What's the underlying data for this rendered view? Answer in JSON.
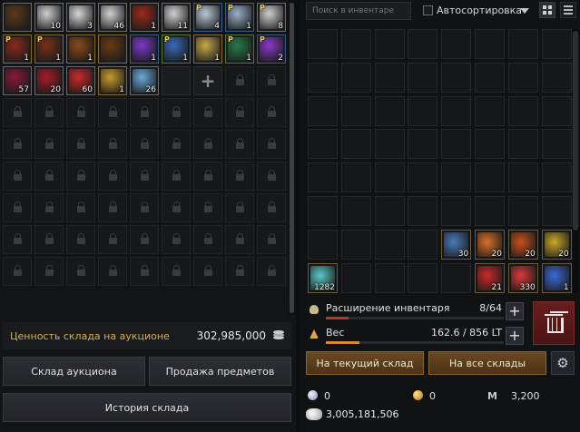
{
  "storage": {
    "slots": [
      {
        "item": "magnifier-key",
        "count": "",
        "grade": "white",
        "p": false,
        "color": "#5a3a1a"
      },
      {
        "item": "paper-map",
        "count": "10",
        "grade": "white",
        "p": false,
        "color": "#cfcfcf"
      },
      {
        "item": "paper-map",
        "count": "3",
        "grade": "white",
        "p": false,
        "color": "#d7d7d7"
      },
      {
        "item": "paper-map",
        "count": "46",
        "grade": "white",
        "p": false,
        "color": "#d2d2d2"
      },
      {
        "item": "red-pouch",
        "count": "1",
        "grade": "white",
        "p": false,
        "color": "#9a2a1a"
      },
      {
        "item": "paper-map",
        "count": "11",
        "grade": "white",
        "p": false,
        "color": "#d0d0d0"
      },
      {
        "item": "ornate-horn",
        "count": "4",
        "grade": "blue",
        "p": true,
        "color": "#b8c8d8"
      },
      {
        "item": "ornate-horn",
        "count": "1",
        "grade": "blue",
        "p": true,
        "color": "#9ab0c8"
      },
      {
        "item": "paper-map",
        "count": "8",
        "grade": "white",
        "p": true,
        "color": "#cfcfcf"
      },
      {
        "item": "treasure-chest",
        "count": "1",
        "grade": "gold",
        "p": true,
        "color": "#8a2a1a"
      },
      {
        "item": "treasure-chest",
        "count": "1",
        "grade": "gold",
        "p": true,
        "color": "#7a3018"
      },
      {
        "item": "treasure-chest",
        "count": "1",
        "grade": "gold",
        "p": false,
        "color": "#8a4a1a"
      },
      {
        "item": "treasure-chest",
        "count": "",
        "grade": "gold",
        "p": false,
        "color": "#6a3a14"
      },
      {
        "item": "purple-crystal",
        "count": "1",
        "grade": "blue",
        "p": false,
        "color": "#7a3ac8"
      },
      {
        "item": "blue-scroll",
        "count": "1",
        "grade": "green",
        "p": true,
        "color": "#3a6ab8"
      },
      {
        "item": "gold-crest",
        "count": "1",
        "grade": "gold",
        "p": false,
        "color": "#c8a84a"
      },
      {
        "item": "emerald-medal",
        "count": "1",
        "grade": "green",
        "p": true,
        "color": "#2a7a4a"
      },
      {
        "item": "purple-chest",
        "count": "2",
        "grade": "blue",
        "p": true,
        "color": "#8a3ac8"
      },
      {
        "item": "crimson-claw",
        "count": "57",
        "grade": "white",
        "p": false,
        "color": "#8a1a3a"
      },
      {
        "item": "red-claw",
        "count": "20",
        "grade": "white",
        "p": false,
        "color": "#a81a2a"
      },
      {
        "item": "red-gem",
        "count": "60",
        "grade": "white",
        "p": false,
        "color": "#c82a2a"
      },
      {
        "item": "gold-ingot",
        "count": "1",
        "grade": "gold",
        "p": false,
        "color": "#c89a2a"
      },
      {
        "item": "blue-potion",
        "count": "26",
        "grade": "white",
        "p": false,
        "color": "#6aa8d8"
      }
    ],
    "auction_value_label": "Ценность склада на аукционе",
    "auction_value": "302,985,000",
    "btn_auction_storage": "Склад аукциона",
    "btn_sell_items": "Продажа предметов",
    "btn_storage_history": "История склада"
  },
  "inventory": {
    "search_placeholder": "Поиск в инвентаре",
    "autosort_label": "Автосортировка",
    "autosort_checked": false,
    "items": [
      {
        "index": 52,
        "item": "blue-orb",
        "count": "30",
        "color": "#4a7ab8"
      },
      {
        "index": 53,
        "item": "fire-orb",
        "count": "20",
        "color": "#d8702a"
      },
      {
        "index": 54,
        "item": "flame-orb",
        "count": "20",
        "color": "#c8501a"
      },
      {
        "index": 55,
        "item": "golden-orb",
        "count": "20",
        "color": "#c8a82a"
      },
      {
        "index": 56,
        "item": "cyan-orb",
        "count": "1282",
        "color": "#5ac8c8"
      },
      {
        "index": 61,
        "item": "red-potion",
        "count": "21",
        "color": "#c82a2a"
      },
      {
        "index": 62,
        "item": "red-potion",
        "count": "330",
        "color": "#d83a3a"
      },
      {
        "index": 63,
        "item": "blue-potion",
        "count": "1",
        "color": "#3a6ad8"
      }
    ],
    "expansion_label": "Расширение инвентаря",
    "expansion_value": "8/64",
    "expansion_fraction": 0.125,
    "expansion_color": "#b03a2a",
    "weight_label": "Вес",
    "weight_value": "162.6 / 856 LT",
    "weight_fraction": 0.19,
    "weight_color": "#d8882a",
    "btn_to_current": "На текущий склад",
    "btn_to_all": "На все склады",
    "currency_pearl": "0",
    "currency_crown": "0",
    "currency_mileage": "3,200",
    "silver": "3,005,181,506"
  }
}
